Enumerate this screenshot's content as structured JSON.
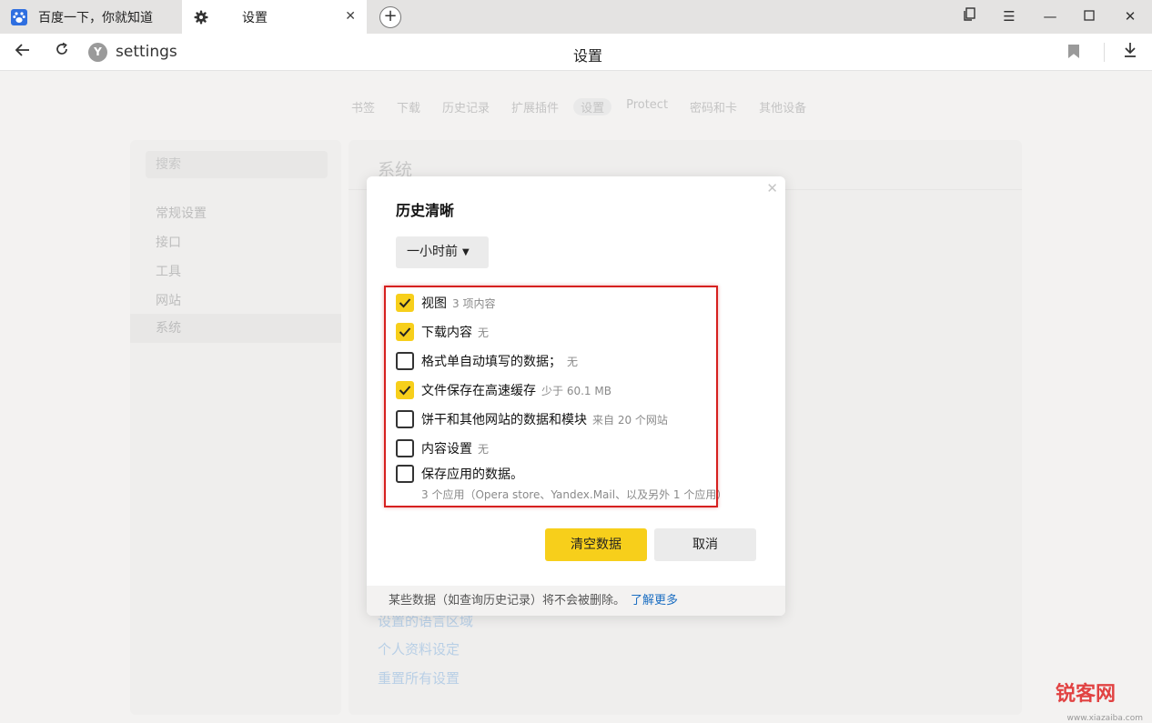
{
  "tabs": [
    {
      "title": "百度一下，你就知道",
      "icon": "baidu-paw-icon"
    },
    {
      "title": "设置",
      "icon": "gear-icon"
    }
  ],
  "address": {
    "text": "settings",
    "badge": "Y",
    "page_title": "设置"
  },
  "topnav": [
    "书签",
    "下载",
    "历史记录",
    "扩展插件",
    "设置",
    "Protect",
    "密码和卡",
    "其他设备"
  ],
  "sidebar": {
    "search_placeholder": "搜索",
    "items": [
      "常规设置",
      "接口",
      "工具",
      "网站",
      "系统"
    ]
  },
  "main": {
    "title": "系统",
    "links": [
      "设置的语言区域",
      "个人资料设定",
      "重置所有设置"
    ]
  },
  "dialog": {
    "title": "历史清晰",
    "range": "一小时前",
    "options": [
      {
        "label": "视图",
        "sub": "3 项内容",
        "checked": true
      },
      {
        "label": "下载内容",
        "sub": "无",
        "checked": true
      },
      {
        "label": "格式单自动填写的数据；",
        "sub": "无",
        "checked": false
      },
      {
        "label": "文件保存在高速缓存",
        "sub": "少于 60.1 MB",
        "checked": true
      },
      {
        "label": "饼干和其他网站的数据和模块",
        "sub": "来自 20 个网站",
        "checked": false
      },
      {
        "label": "内容设置",
        "sub": "无",
        "checked": false
      },
      {
        "label": "保存应用的数据。",
        "sub": "",
        "checked": false
      }
    ],
    "apps_desc": "3 个应用（Opera store、Yandex.Mail、以及另外 1 个应用）",
    "clear_label": "清空数据",
    "cancel_label": "取消",
    "footer_text": "某些数据（如查询历史记录）将不会被删除。",
    "footer_link": "了解更多"
  },
  "colors": {
    "accent": "#f7cf1b",
    "link": "#1b6ec2",
    "highlight": "#d6201f"
  },
  "watermark": {
    "text": "锐客网",
    "sub": "www.xiazaiba.com"
  }
}
